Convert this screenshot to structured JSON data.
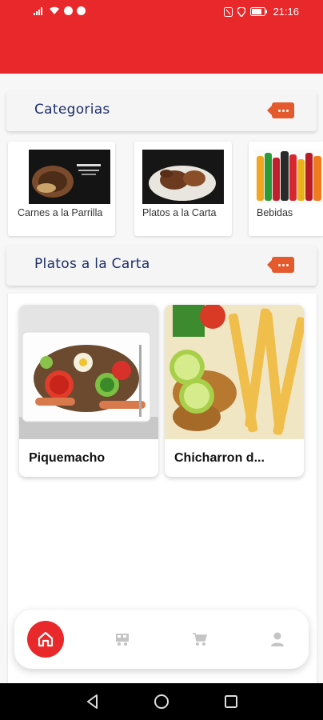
{
  "status_bar": {
    "time": "21:16",
    "battery_icon": "battery-icon",
    "icons_left": [
      "signal-icon",
      "wifi-icon",
      "facebook-icon",
      "youtube-icon"
    ],
    "icons_right": [
      "nfc-icon",
      "location-icon"
    ]
  },
  "colors": {
    "brand": "#e8282a",
    "title": "#1d2e6b",
    "badge": "#e55a2d"
  },
  "categories_section": {
    "title": "Categorias",
    "more_icon": "more-icon",
    "items": [
      {
        "label": "Carnes a la Parrilla"
      },
      {
        "label": "Platos a la Carta"
      },
      {
        "label": "Bebidas"
      }
    ]
  },
  "plates_section": {
    "title": "Platos a la Carta",
    "more_icon": "more-icon",
    "items": [
      {
        "name": "Piquemacho"
      },
      {
        "name": "Chicharron d..."
      }
    ]
  },
  "bottom_nav": {
    "items": [
      {
        "icon": "home-icon",
        "active": true
      },
      {
        "icon": "delivery-icon",
        "active": false
      },
      {
        "icon": "cart-icon",
        "active": false
      },
      {
        "icon": "user-icon",
        "active": false
      }
    ]
  },
  "system_nav": [
    "back-icon",
    "home-circle-icon",
    "recents-icon"
  ]
}
